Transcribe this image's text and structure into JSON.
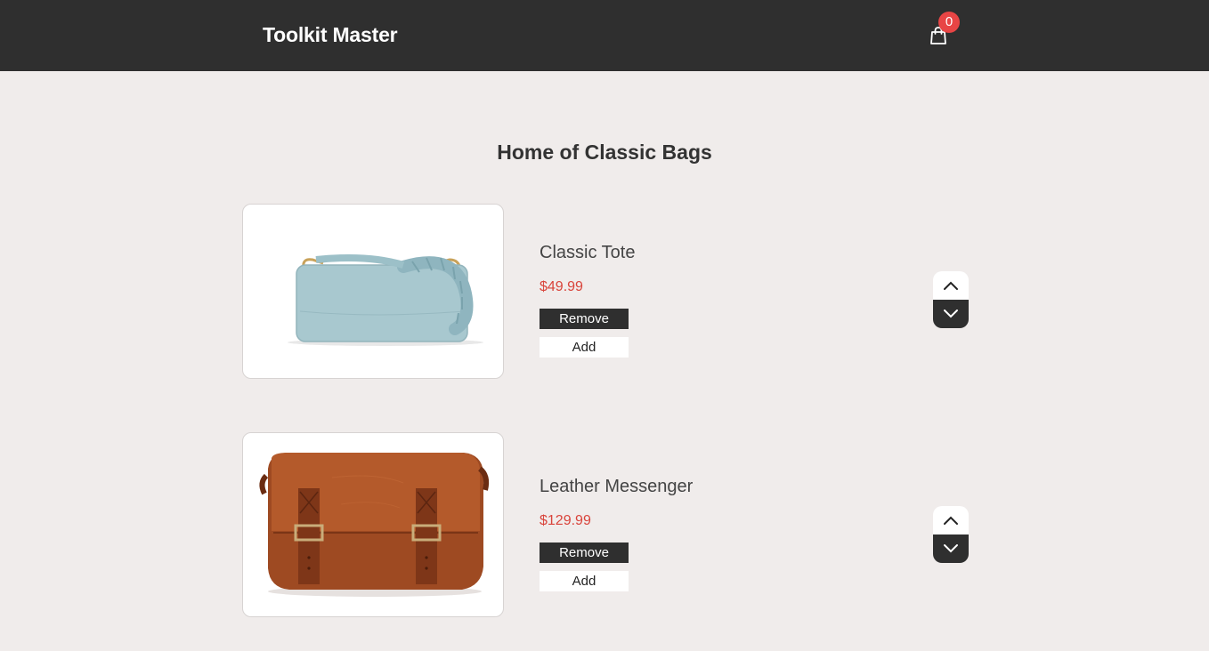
{
  "header": {
    "brand": "Toolkit Master",
    "cart_count": "0",
    "cart_icon": "shopping-bag-icon"
  },
  "main": {
    "title": "Home of Classic Bags",
    "products": [
      {
        "name": "Classic Tote",
        "price": "$49.99",
        "remove_label": "Remove",
        "add_label": "Add",
        "image": "light-blue-handbag-image"
      },
      {
        "name": "Leather Messenger",
        "price": "$129.99",
        "remove_label": "Remove",
        "add_label": "Add",
        "image": "brown-leather-messenger-image"
      }
    ]
  },
  "colors": {
    "header_bg": "#2f2f2f",
    "page_bg": "#f0eceb",
    "price": "#d9443b",
    "badge": "#e84545"
  }
}
